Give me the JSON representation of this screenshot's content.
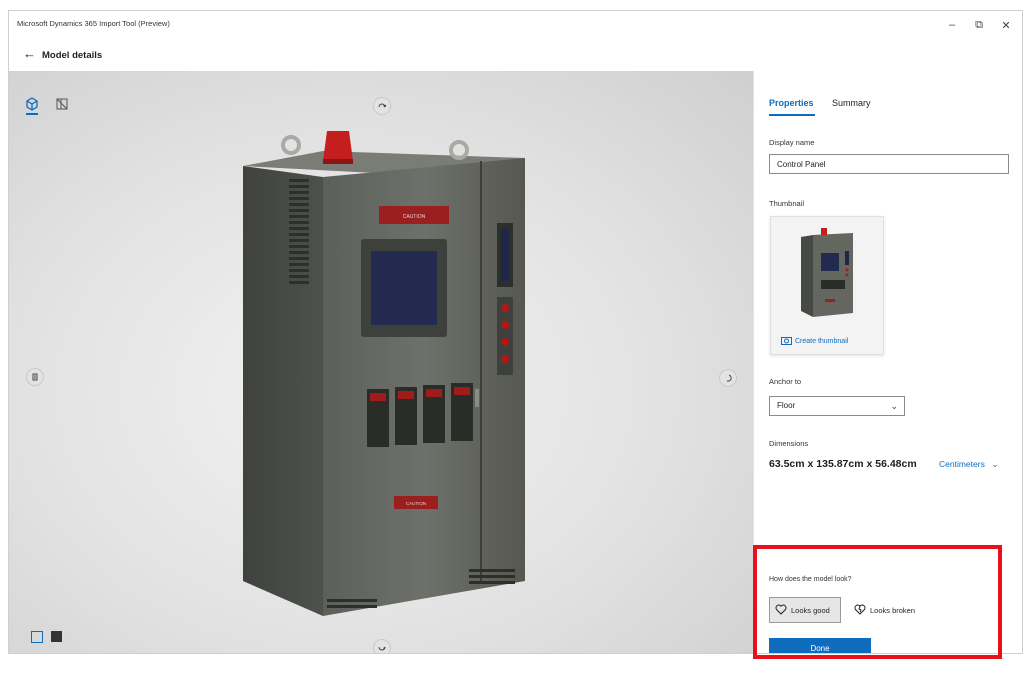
{
  "app": {
    "title": "Microsoft Dynamics 365 Import Tool (Preview)"
  },
  "window_controls": {
    "minimize": "–",
    "restore": "⧉",
    "close": "✕"
  },
  "header": {
    "back_icon": "←",
    "page_title": "Model details"
  },
  "viewport": {
    "view_icons": [
      "3d-view-icon",
      "wireframe-view-icon"
    ],
    "controls": [
      "rotate-up-icon",
      "rotate-left-icon",
      "rotate-right-icon",
      "rotate-down-icon"
    ],
    "background_toggles": [
      "light-background-icon",
      "dark-background-icon"
    ],
    "model_label_top": "CAUTION",
    "model_label_bottom": "CAUTION"
  },
  "properties": {
    "tabs": [
      "Properties",
      "Summary"
    ],
    "active_tab": "Properties",
    "display_name_label": "Display name",
    "display_name_value": "Control Panel",
    "thumbnail_label": "Thumbnail",
    "create_thumbnail_label": "Create thumbnail",
    "anchor_label": "Anchor to",
    "anchor_value": "Floor",
    "dimensions_label": "Dimensions",
    "dimensions_value": "63.5cm x 135.87cm x 56.48cm",
    "units_value": "Centimeters",
    "feedback_question": "How does the model look?",
    "looks_good_label": "Looks good",
    "looks_broken_label": "Looks broken",
    "done_label": "Done"
  },
  "colors": {
    "accent": "#0f6cbd",
    "highlight": "#e8101a"
  }
}
